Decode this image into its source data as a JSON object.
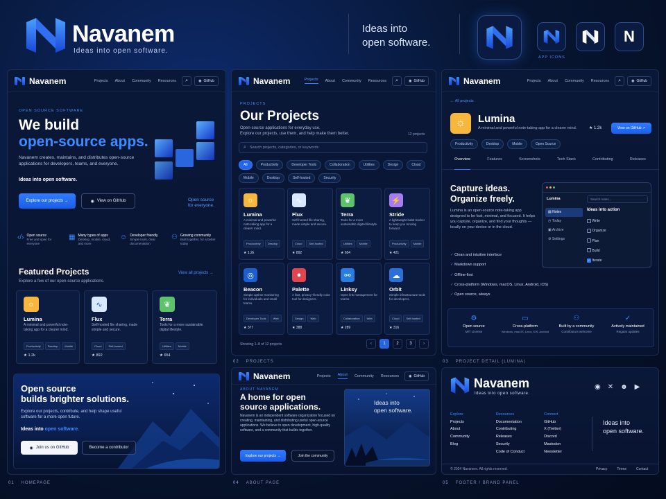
{
  "brand": {
    "name": "Navanem",
    "tagline": "Ideas into open software.",
    "tagline_l1": "Ideas into",
    "tagline_l2": "open software.",
    "app_icons_label": "APP ICONS"
  },
  "colors": {
    "accent": "#2f7cff",
    "bg": "#071633",
    "panel": "#0a1838"
  },
  "nav": {
    "projects": "Projects",
    "about": "About",
    "community": "Community",
    "resources": "Resources",
    "github": "GitHub"
  },
  "home": {
    "eyebrow": "OPEN SOURCE SOFTWARE",
    "h1": "We build",
    "h1b": "open-source apps.",
    "intro": "Navanem creates, maintains, and distributes open-source applications for developers, teams, and everyone.",
    "intro_strong": "Ideas into open software.",
    "btn_explore": "Explore our projects →",
    "btn_github": "View on GitHub",
    "side_note1": "Open source",
    "side_note2": "for everyone.",
    "features": [
      {
        "icon": "code-icon",
        "t": "Open source",
        "d": "Free and open for everyone"
      },
      {
        "icon": "apps-icon",
        "t": "Many types of apps",
        "d": "Desktop, mobile, cloud, and more"
      },
      {
        "icon": "developer-icon",
        "t": "Developer friendly",
        "d": "Simple tools, clear documentation"
      },
      {
        "icon": "community-icon",
        "t": "Growing community",
        "d": "Built together, for a better today"
      }
    ],
    "featured_title": "Featured Projects",
    "featured_sub": "Explore a few of our open-source applications.",
    "view_all": "View all projects →",
    "cards": [
      {
        "name": "Lumina",
        "desc": "A minimal and powerful note-taking app for a clearer mind.",
        "tags": [
          "Productivity",
          "Desktop",
          "Mobile"
        ],
        "stars": "1.2k",
        "icon": "☼",
        "bg": "#f6b73c"
      },
      {
        "name": "Flux",
        "desc": "Self-hosted file sharing, made simple and secure.",
        "tags": [
          "Cloud",
          "Self-hosted"
        ],
        "stars": "892",
        "icon": "∿",
        "bg": "#d8e8ff"
      },
      {
        "name": "Terra",
        "desc": "Tools for a more sustainable digital lifestyle.",
        "tags": [
          "Utilities",
          "Mobile"
        ],
        "stars": "654",
        "icon": "❦",
        "bg": "#5cc36a"
      }
    ],
    "cta_h1": "Open source",
    "cta_h2": "builds brighter solutions.",
    "cta_p": "Explore our projects, contribute, and help shape useful software for a more open future.",
    "cta_strong": "Ideas into",
    "cta_strong_b": "open software.",
    "btn_join": "Join us on GitHub",
    "btn_contrib": "Become a contributor"
  },
  "projects": {
    "eyebrow": "PROJECTS",
    "title": "Our Projects",
    "sub": "Open-source applications for everyday use.",
    "sub2": "Explore our projects, use them, and help make them better.",
    "count": "12 projects",
    "search_ph": "Search projects, categories, or keywords",
    "filters": [
      "All",
      "Productivity",
      "Developer Tools",
      "Collaboration",
      "Utilities",
      "Design",
      "Cloud",
      "Mobile",
      "Desktop",
      "Self-hosted",
      "Security"
    ],
    "cards": [
      {
        "name": "Lumina",
        "desc": "A minimal and powerful note-taking app for a clearer mind.",
        "tags": [
          "Productivity",
          "Desktop"
        ],
        "stars": "1.2k",
        "icon": "☼",
        "bg": "#f6b73c"
      },
      {
        "name": "Flux",
        "desc": "Self-hosted file sharing, made simple and secure.",
        "tags": [
          "Cloud",
          "Self-hosted"
        ],
        "stars": "892",
        "icon": "∿",
        "bg": "#d8e8ff"
      },
      {
        "name": "Terra",
        "desc": "Tools for a more sustainable digital lifestyle.",
        "tags": [
          "Utilities",
          "Mobile"
        ],
        "stars": "654",
        "icon": "❦",
        "bg": "#5cc36a"
      },
      {
        "name": "Stride",
        "desc": "A lightweight habit tracker to keep you moving forward.",
        "tags": [
          "Productivity",
          "Mobile"
        ],
        "stars": "421",
        "icon": "⚡",
        "bg": "#a77bf3"
      },
      {
        "name": "Beacon",
        "desc": "Simple uptime monitoring for individuals and small teams.",
        "tags": [
          "Developer Tools",
          "Web"
        ],
        "stars": "377",
        "icon": "◎",
        "bg": "#1c5fd0"
      },
      {
        "name": "Palette",
        "desc": "A fast, privacy-friendly color tool for designers.",
        "tags": [
          "Design",
          "Web"
        ],
        "stars": "388",
        "icon": "●",
        "bg": "#e0454e"
      },
      {
        "name": "Linksy",
        "desc": "Open link management for teams.",
        "tags": [
          "Collaboration",
          "Web"
        ],
        "stars": "289",
        "icon": "⚯",
        "bg": "#2a7de0"
      },
      {
        "name": "Orbit",
        "desc": "Simple infrastructure tools for developers.",
        "tags": [
          "Cloud",
          "Self-hosted"
        ],
        "stars": "316",
        "icon": "☁",
        "bg": "#2b6fd8"
      }
    ],
    "showing": "Showing 1–8 of 12 projects",
    "pages": [
      "1",
      "2",
      "3"
    ]
  },
  "detail": {
    "back": "← All projects",
    "name": "Lumina",
    "desc": "A minimal and powerful note-taking app for a clearer mind.",
    "stars": "1.2k",
    "btn_github": "View on GitHub ↗",
    "tags": [
      "Productivity",
      "Desktop",
      "Mobile",
      "Open Source"
    ],
    "tabs": [
      "Overview",
      "Features",
      "Screenshots",
      "Tech Stack",
      "Contributing",
      "Releases"
    ],
    "h1": "Capture ideas.",
    "h2": "Organize freely.",
    "p": "Lumina is an open-source note-taking app designed to be fast, minimal, and focused. It helps you capture, organize, and find your thoughts — locally on your device or in the cloud.",
    "checks": [
      "Clean and intuitive interface",
      "Markdown support",
      "Offline-first",
      "Cross-platform (Windows, macOS, Linux, Android, iOS)",
      "Open source, always"
    ],
    "mock": {
      "app": "Lumina",
      "search": "Search notes...",
      "side": [
        "Notes",
        "Today",
        "Archive",
        "Settings"
      ],
      "list_title": "Ideas into action",
      "items": [
        "Write",
        "Organize",
        "Plan",
        "Build",
        "Iterate"
      ]
    },
    "stats": [
      {
        "t": "Open source",
        "d": "MIT License"
      },
      {
        "t": "Cross-platform",
        "d": "Windows, macOS, Linux, iOS, Android"
      },
      {
        "t": "Built by a community",
        "d": "Contributors welcome"
      },
      {
        "t": "Actively maintained",
        "d": "Regular updates"
      }
    ]
  },
  "about": {
    "eyebrow": "ABOUT NAVANEM",
    "h1": "A home for open",
    "h2": "source applications.",
    "p": "Navanem is an independent software organization focused on creating, maintaining, and distributing useful open-source applications. We believe in open development, high-quality software, and a community that builds together.",
    "btn1": "Explore our projects →",
    "btn2": "Join the community",
    "img_l1": "Ideas into",
    "img_l2": "open software."
  },
  "footer": {
    "cols": [
      {
        "title": "Explore",
        "items": [
          "Projects",
          "About",
          "Community",
          "Blog"
        ]
      },
      {
        "title": "Resources",
        "items": [
          "Documentation",
          "Contributing",
          "Releases",
          "Security",
          "Code of Conduct"
        ]
      },
      {
        "title": "Connect",
        "items": [
          "GitHub",
          "X (Twitter)",
          "Discord",
          "Mastodon",
          "Newsletter"
        ]
      }
    ],
    "copy": "© 2024 Navanem. All rights reserved.",
    "links": [
      "Privacy",
      "Terms",
      "Contact"
    ]
  },
  "captions": [
    {
      "n": "01",
      "t": "HOMEPAGE"
    },
    {
      "n": "02",
      "t": "PROJECTS"
    },
    {
      "n": "03",
      "t": "PROJECT DETAIL (LUMINA)"
    },
    {
      "n": "04",
      "t": "ABOUT PAGE"
    },
    {
      "n": "05",
      "t": "FOOTER / BRAND PANEL"
    }
  ]
}
